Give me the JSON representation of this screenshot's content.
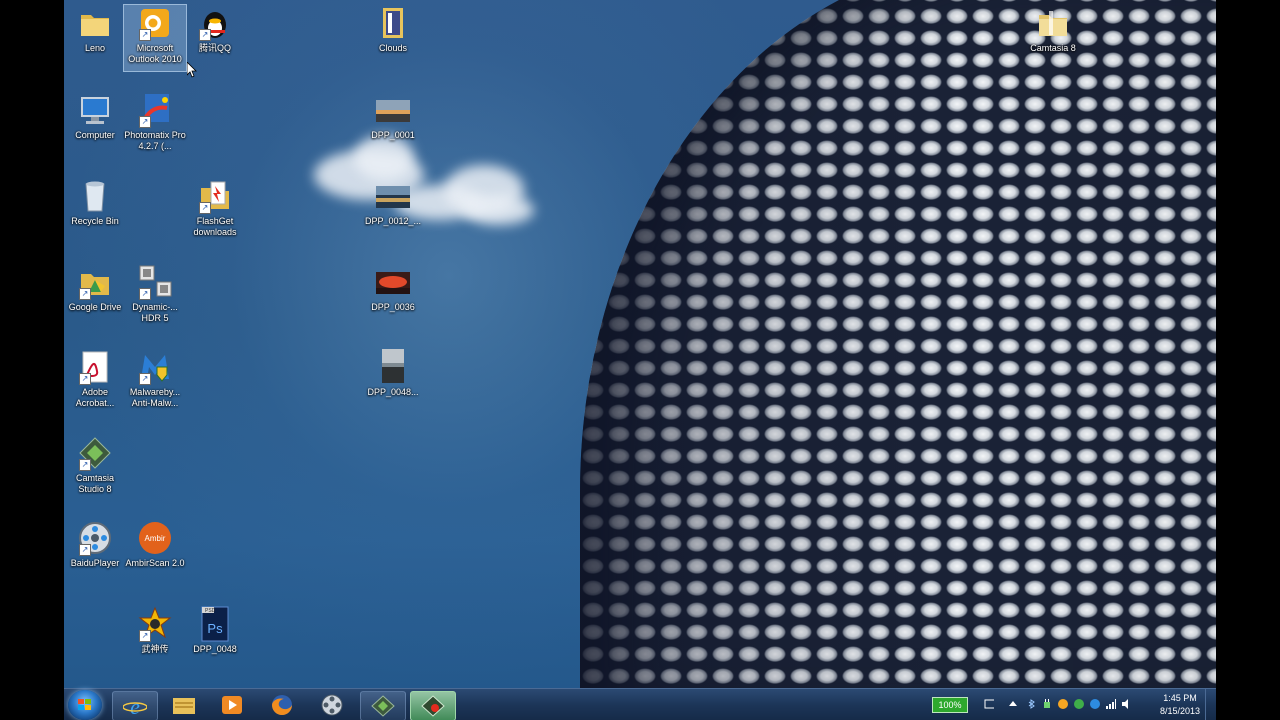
{
  "desktop": {
    "icons": [
      {
        "label": "Leno",
        "icon": "folder-icon"
      },
      {
        "label": "Microsoft Outlook 2010",
        "icon": "outlook-icon"
      },
      {
        "label": "腾讯QQ",
        "icon": "qq-penguin-icon"
      },
      {
        "label": "Clouds",
        "icon": "folder-docs-icon"
      },
      {
        "label": "Camtasia 8",
        "icon": "folder-icon"
      },
      {
        "label": "Computer",
        "icon": "computer-icon"
      },
      {
        "label": "Photomatix Pro 4.2.7 (...",
        "icon": "photomatix-icon"
      },
      {
        "label": "DPP_0001",
        "icon": "photo-thumbnail-icon"
      },
      {
        "label": "Recycle Bin",
        "icon": "recycle-bin-icon"
      },
      {
        "label": "FlashGet downloads",
        "icon": "folder-flashget-icon"
      },
      {
        "label": "DPP_0012_...",
        "icon": "photo-thumbnail-icon"
      },
      {
        "label": "Google Drive",
        "icon": "google-drive-icon"
      },
      {
        "label": "Dynamic-... HDR 5",
        "icon": "dynamic-hdr-icon"
      },
      {
        "label": "DPP_0036",
        "icon": "photo-thumbnail-icon"
      },
      {
        "label": "Adobe Acrobat...",
        "icon": "acrobat-icon"
      },
      {
        "label": "Malwareby... Anti-Malw...",
        "icon": "malwarebytes-icon"
      },
      {
        "label": "DPP_0048...",
        "icon": "photo-thumbnail-icon"
      },
      {
        "label": "Camtasia Studio 8",
        "icon": "camtasia-icon"
      },
      {
        "label": "BaiduPlayer",
        "icon": "baiduplayer-icon"
      },
      {
        "label": "AmbirScan 2.0",
        "icon": "ambirscan-icon"
      },
      {
        "label": "武神传",
        "icon": "game-icon"
      },
      {
        "label": "DPP_0048",
        "icon": "photoshop-psd-icon"
      }
    ]
  },
  "taskbar": {
    "start_label": "Start",
    "pinned": [
      "internet-explorer-icon",
      "windows-explorer-icon",
      "media-player-icon",
      "firefox-icon",
      "film-reel-icon",
      "camtasia-icon",
      "camtasia-recorder-icon"
    ],
    "tray": {
      "battery": "100%",
      "time": "1:45 PM",
      "date": "8/15/2013"
    }
  },
  "colors": {
    "taskbar": "#1c3558",
    "sky": "#2f5b8e",
    "active_task": "#4fa060"
  }
}
